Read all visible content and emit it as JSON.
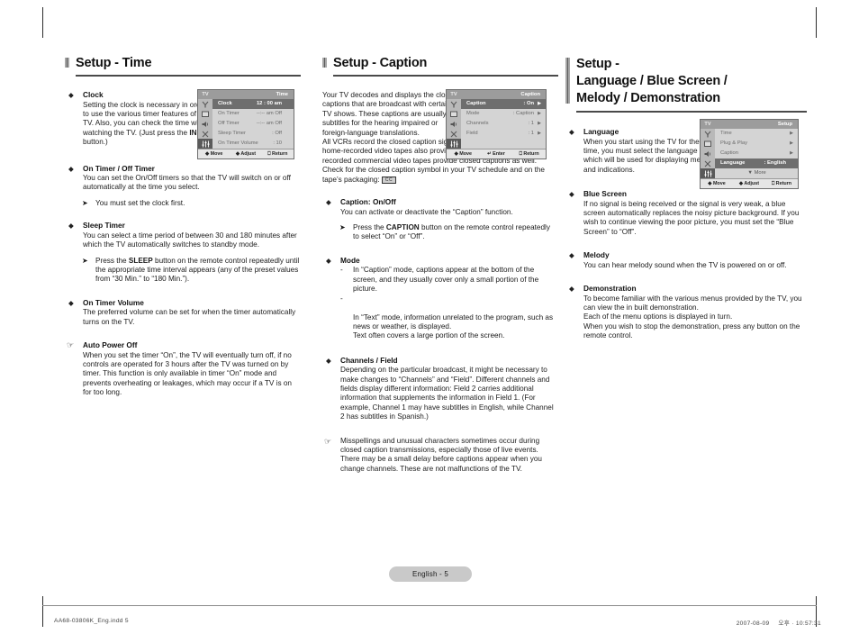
{
  "document": {
    "page_badge": "English - 5",
    "footer_file": "AA68-03806K_Eng.indd   5",
    "footer_date": "2007-08-09",
    "footer_korean": "오후",
    "footer_time": "10:57:31"
  },
  "left_column": {
    "title": "Setup - Time",
    "sections": [
      {
        "bullet": "◆",
        "heading": "Clock",
        "body": "Setting the clock is necessary in order to use the various timer features of the TV. Also, you can check the time while watching the TV. (Just press the INFO button.)",
        "body_pre": "Setting the clock is necessary in order to use the various timer features of the TV. Also, you can check the time while watching the TV. (Just press the ",
        "body_bold": "INFO",
        "body_post": " button.)"
      },
      {
        "bullet": "◆",
        "heading": "On Timer / Off Timer",
        "body": "You can set the On/Off timers so that the TV will switch on or off automatically at the time you select.",
        "note": "You must set the clock first."
      },
      {
        "bullet": "◆",
        "heading": "Sleep Timer",
        "body": "You can select a time period of between 30 and 180 minutes after which the TV automatically switches to standby mode.",
        "note_pre": "Press the ",
        "note_bold": "SLEEP",
        "note_post": " button on the remote control repeatedly until the appropriate time interval appears (any of the preset values from “30 Min.” to “180 Min.”)."
      },
      {
        "bullet": "◆",
        "heading": "On Timer Volume",
        "body": "The preferred volume can be set for when the timer automatically turns on the TV."
      },
      {
        "bullet": "☞",
        "heading": "Auto Power Off",
        "body": "When you set the timer “On”, the TV will eventually turn off, if no controls are operated for 3 hours after the TV was turned on by timer. This function is only available in timer “On” mode and prevents overheating or leakages, which may occur if a TV is on for too long."
      }
    ]
  },
  "middle_column": {
    "title": "Setup - Caption",
    "intro": "Your TV decodes and displays the closed captions that are broadcast with certain TV shows. These captions are usually subtitles for the hearing impaired or foreign-language translations.",
    "intro2_pre": "All VCRs record the closed caption signal from TV programs, so home-recorded video tapes also provide closed captions. Most pre-recorded commercial video tapes provide closed captions as well. Check for the closed caption symbol in your TV schedule and on the tape’s packaging: ",
    "intro2_icon": "CC",
    "sections": [
      {
        "bullet": "◆",
        "heading": "Caption: On/Off",
        "body": "You can activate or deactivate the “Caption” function.",
        "note_pre": "Press the ",
        "note_bold": "CAPTION",
        "note_post": " button on the remote control repeatedly to select “On” or “Off”."
      },
      {
        "bullet": "◆",
        "heading": "Mode",
        "dashes": [
          "In “Caption” mode, captions appear at the bottom of the screen, and they usually cover only a small portion of the picture.",
          "In “Text” mode, information unrelated to the program, such as news or weather, is displayed.\nText often covers a large portion of the screen."
        ]
      },
      {
        "bullet": "◆",
        "heading": "Channels / Field",
        "body": "Depending on the particular broadcast, it might be necessary to make changes to “Channels” and “Field”. Different channels and fields display different information: Field 2 carries additional information that supplements the information in Field 1. (For example, Channel 1 may have subtitles in English, while Channel 2 has subtitles in Spanish.)"
      },
      {
        "bullet": "☞",
        "heading": "",
        "body": "Misspellings and unusual characters sometimes occur during closed caption transmissions, especially those of live events. There may be a small delay before captions appear when you change channels. These are not malfunctions of the TV."
      }
    ]
  },
  "right_column": {
    "title_line1": "Setup -",
    "title_line2": "Language / Blue Screen /",
    "title_line3": "Melody / Demonstration",
    "sections": [
      {
        "bullet": "◆",
        "heading": "Language",
        "body": "When you start using the TV for the first time, you must select the language which will be used for displaying menus and indications."
      },
      {
        "bullet": "◆",
        "heading": "Blue Screen",
        "body": "If no signal is being received or the signal is very weak, a blue screen automatically replaces the noisy picture background. If you wish to continue viewing the poor picture, you must set the “Blue Screen” to “Off”."
      },
      {
        "bullet": "◆",
        "heading": "Melody",
        "body": "You can hear melody sound when the TV is powered on or off."
      },
      {
        "bullet": "◆",
        "heading": "Demonstration",
        "body": "To become familiar with the various menus provided by the TV, you can view the in built demonstration.\nEach of the menu options is displayed in turn.\nWhen you wish to stop the demonstration, press any button on the remote control."
      }
    ]
  },
  "osd_time": {
    "tv_tag": "TV",
    "title": "Time",
    "rows": [
      {
        "label": "Clock",
        "value": "12 : 00 am",
        "selected": true
      },
      {
        "label": "On Timer",
        "value": "--:--   am  Off",
        "selected": false
      },
      {
        "label": "Off Timer",
        "value": "--:--   am  Off",
        "selected": false
      },
      {
        "label": "Sleep Timer",
        "value": ": Off",
        "selected": false
      },
      {
        "label": "On Timer Volume",
        "value": ": 10",
        "selected": false
      }
    ],
    "foot": {
      "move": "Move",
      "adjust": "Adjust",
      "return": "Return"
    }
  },
  "osd_caption": {
    "tv_tag": "TV",
    "title": "Caption",
    "rows": [
      {
        "label": "Caption",
        "value": ": On",
        "selected": true,
        "arrow": "▶"
      },
      {
        "label": "Mode",
        "value": ": Caption",
        "selected": false,
        "arrow": "▶"
      },
      {
        "label": "Channels",
        "value": ": 1",
        "selected": false,
        "arrow": "▶"
      },
      {
        "label": "Field",
        "value": ": 1",
        "selected": false,
        "arrow": "▶"
      }
    ],
    "foot": {
      "move": "Move",
      "enter": "Enter",
      "return": "Return"
    }
  },
  "osd_setup": {
    "tv_tag": "TV",
    "title": "Setup",
    "rows": [
      {
        "label": "Time",
        "value": "",
        "selected": false,
        "arrow": "▶"
      },
      {
        "label": "Plug & Play",
        "value": "",
        "selected": false,
        "arrow": "▶"
      },
      {
        "label": "Caption",
        "value": "",
        "selected": false,
        "arrow": "▶"
      },
      {
        "label": "Language",
        "value": ": English",
        "selected": true,
        "arrow": ""
      },
      {
        "label": "▼ More",
        "value": "",
        "selected": false,
        "arrow": ""
      }
    ],
    "foot": {
      "move": "Move",
      "adjust": "Adjust",
      "return": "Return"
    }
  }
}
